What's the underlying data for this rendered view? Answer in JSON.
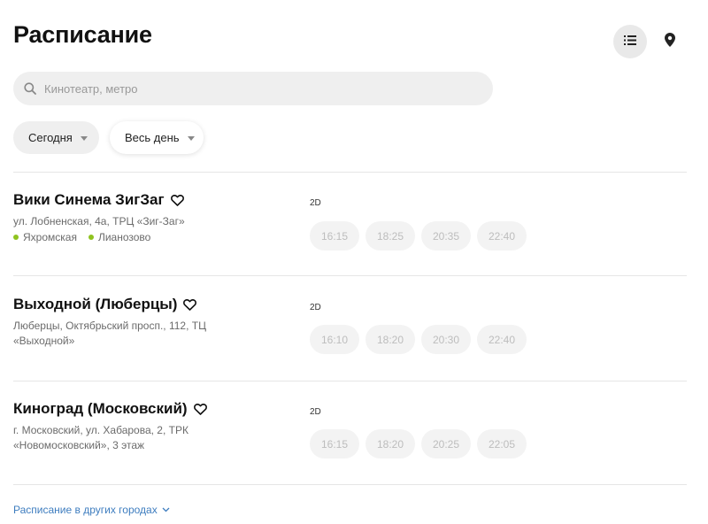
{
  "header": {
    "title": "Расписание",
    "list_view_icon": "list-icon",
    "map_view_icon": "location-pin-icon"
  },
  "search": {
    "value": "",
    "placeholder": "Кинотеатр, метро",
    "icon": "search-icon"
  },
  "filters": {
    "date": "Сегодня",
    "time": "Весь день"
  },
  "colors": {
    "metro_dot": "#8fc31f",
    "link": "#3e7dbf",
    "session_bg": "#f3f3f3",
    "session_text": "#bdbdbd"
  },
  "cinemas": [
    {
      "name": "Вики Синема ЗигЗаг",
      "address": "ул. Лобненская, 4а, ТРЦ «Зиг-Заг»",
      "metro": [
        "Яхромская",
        "Лианозово"
      ],
      "format": "2D",
      "sessions": [
        "16:15",
        "18:25",
        "20:35",
        "22:40"
      ]
    },
    {
      "name": "Выходной (Люберцы)",
      "address": "Люберцы, Октябрьский просп., 112, ТЦ «Выходной»",
      "metro": [],
      "format": "2D",
      "sessions": [
        "16:10",
        "18:20",
        "20:30",
        "22:40"
      ]
    },
    {
      "name": "Киноград (Московский)",
      "address": "г. Московский, ул. Хабарова, 2, ТРК «Новомосковский», 3 этаж",
      "metro": [],
      "format": "2D",
      "sessions": [
        "16:15",
        "18:20",
        "20:25",
        "22:05"
      ]
    }
  ],
  "footer": {
    "other_cities_label": "Расписание в других городах"
  }
}
